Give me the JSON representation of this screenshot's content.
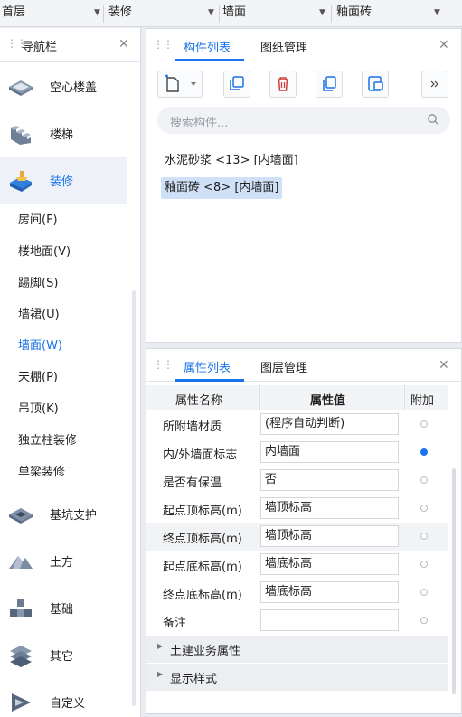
{
  "topbar": {
    "floor": "首层",
    "type": "装修",
    "component": "墙面",
    "instance": "釉面砖"
  },
  "nav": {
    "title": "导航栏",
    "big_items": [
      {
        "label": "空心楼盖",
        "icon": "hollow-slab-icon"
      },
      {
        "label": "楼梯",
        "icon": "stair-icon"
      },
      {
        "label": "装修",
        "icon": "decoration-icon",
        "active": true
      }
    ],
    "sub_items": [
      "房间(F)",
      "楼地面(V)",
      "踢脚(S)",
      "墙裙(U)",
      "墙面(W)",
      "天棚(P)",
      "吊顶(K)",
      "独立柱装修",
      "单梁装修"
    ],
    "active_sub": "墙面(W)",
    "lower_items": [
      {
        "label": "基坑支护",
        "icon": "foundation-pit-icon"
      },
      {
        "label": "土方",
        "icon": "earthwork-icon"
      },
      {
        "label": "基础",
        "icon": "foundation-icon"
      },
      {
        "label": "其它",
        "icon": "other-icon"
      },
      {
        "label": "自定义",
        "icon": "custom-icon"
      }
    ]
  },
  "component_panel": {
    "tabs": [
      "构件列表",
      "图纸管理"
    ],
    "search_placeholder": "搜索构件...",
    "items": [
      {
        "label": "水泥砂浆 <13> [内墙面]",
        "selected": false
      },
      {
        "label": "釉面砖 <8> [内墙面]",
        "selected": true
      }
    ]
  },
  "property_panel": {
    "tabs": [
      "属性列表",
      "图层管理"
    ],
    "headers": [
      "属性名称",
      "属性值",
      "附加"
    ],
    "rows": [
      {
        "name": "所附墙材质",
        "value": "(程序自动判断)",
        "checked": false
      },
      {
        "name": "内/外墙面标志",
        "value": "内墙面",
        "checked": true
      },
      {
        "name": "是否有保温",
        "value": "否",
        "checked": false
      },
      {
        "name": "起点顶标高(m)",
        "value": "墙顶标高",
        "checked": false
      },
      {
        "name": "终点顶标高(m)",
        "value": "墙顶标高",
        "checked": false
      },
      {
        "name": "起点底标高(m)",
        "value": "墙底标高",
        "checked": false
      },
      {
        "name": "终点底标高(m)",
        "value": "墙底标高",
        "checked": false
      },
      {
        "name": "备注",
        "value": "",
        "checked": false
      }
    ],
    "sections": [
      "土建业务属性",
      "显示样式"
    ]
  },
  "colors": {
    "accent": "#1a73e8",
    "selection": "#cfe0f7"
  }
}
